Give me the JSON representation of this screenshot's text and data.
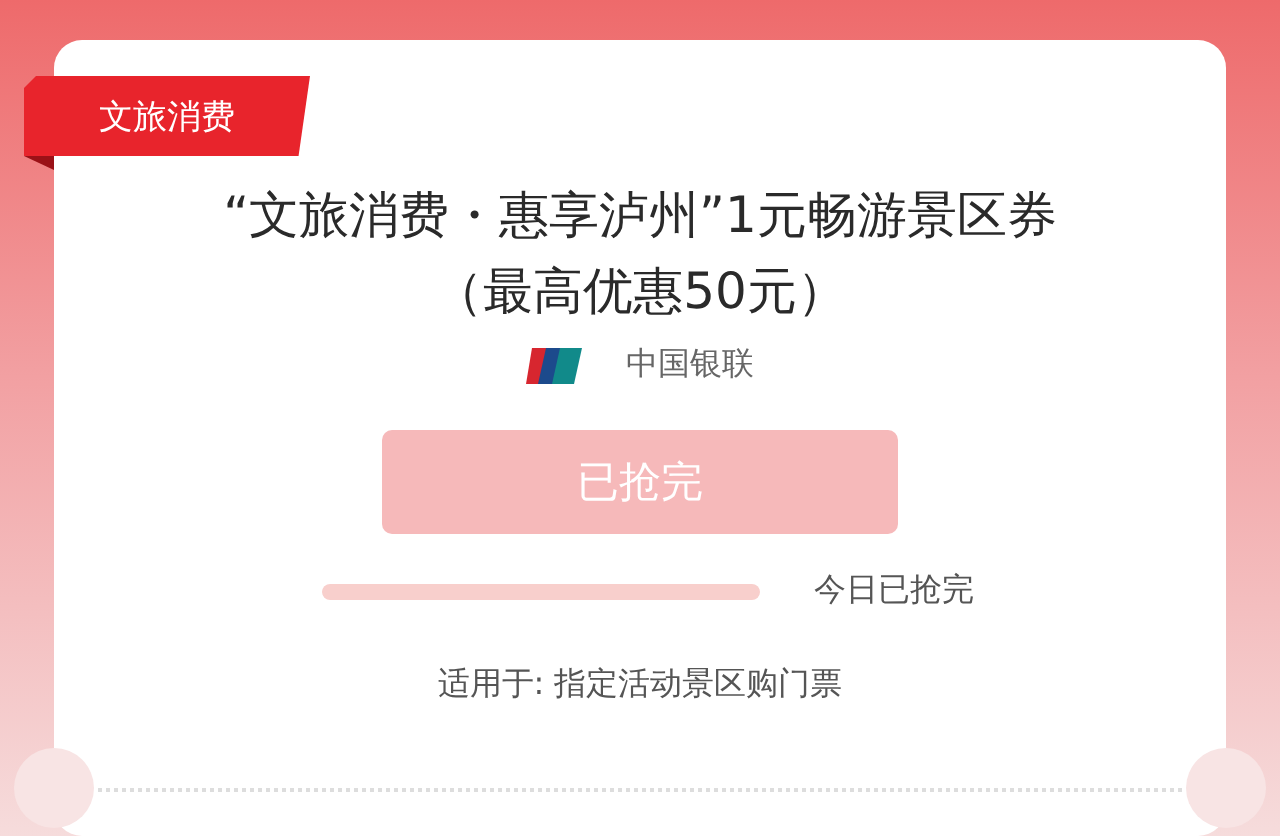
{
  "tag": "文旅消费",
  "title_lines": [
    "“文旅消费・惠享泸州”1元畅游景区券",
    "（最高优惠50元）"
  ],
  "issuer": "中国银联",
  "button": {
    "label": "已抢完",
    "disabled": true
  },
  "progress": {
    "level": 1,
    "status": "今日已抢完"
  },
  "scope": "适用于: 指定活动景区购门票"
}
